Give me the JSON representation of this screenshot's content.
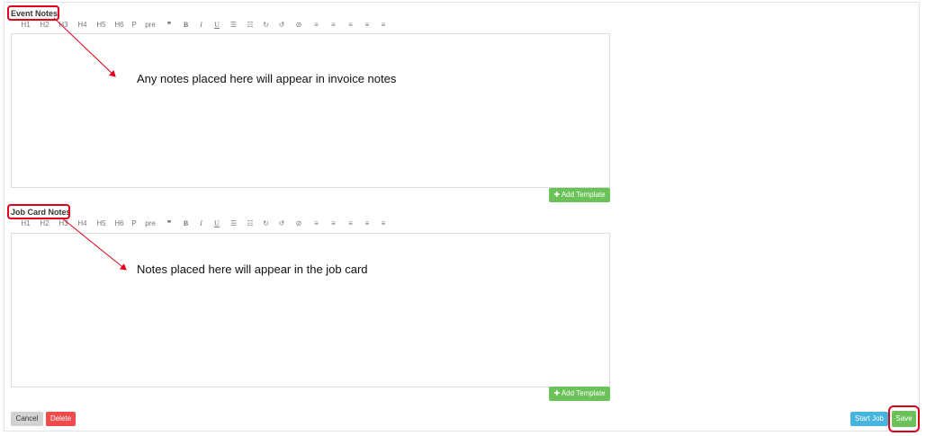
{
  "event_notes": {
    "label": "Event Notes",
    "add_template_label": "Add Template",
    "annotation": "Any notes placed here will appear in invoice notes"
  },
  "job_card_notes": {
    "label": "Job Card Notes",
    "add_template_label": "Add Template",
    "annotation": "Notes placed here will appear in the job card"
  },
  "toolbar": {
    "h1": "H1",
    "h2": "H2",
    "h3": "H3",
    "h4": "H4",
    "h5": "H5",
    "h6": "H6",
    "p": "P",
    "pre": "pre",
    "quote": "❞",
    "bold": "B",
    "italic": "I",
    "underline": "U",
    "ul": "☰",
    "ol": "☷",
    "redo": "↻",
    "undo": "↺",
    "clear": "⊘",
    "align_left": "≡",
    "align_center": "≡",
    "align_right": "≡",
    "indent": "≡",
    "outdent": "≡"
  },
  "footer": {
    "cancel_label": "Cancel",
    "delete_label": "Delete",
    "start_job_label": "Start Job",
    "save_label": "Save"
  },
  "colors": {
    "highlight": "#e0001b",
    "green": "#6ac259",
    "red": "#ee4c4c",
    "blue": "#45b5dd"
  }
}
